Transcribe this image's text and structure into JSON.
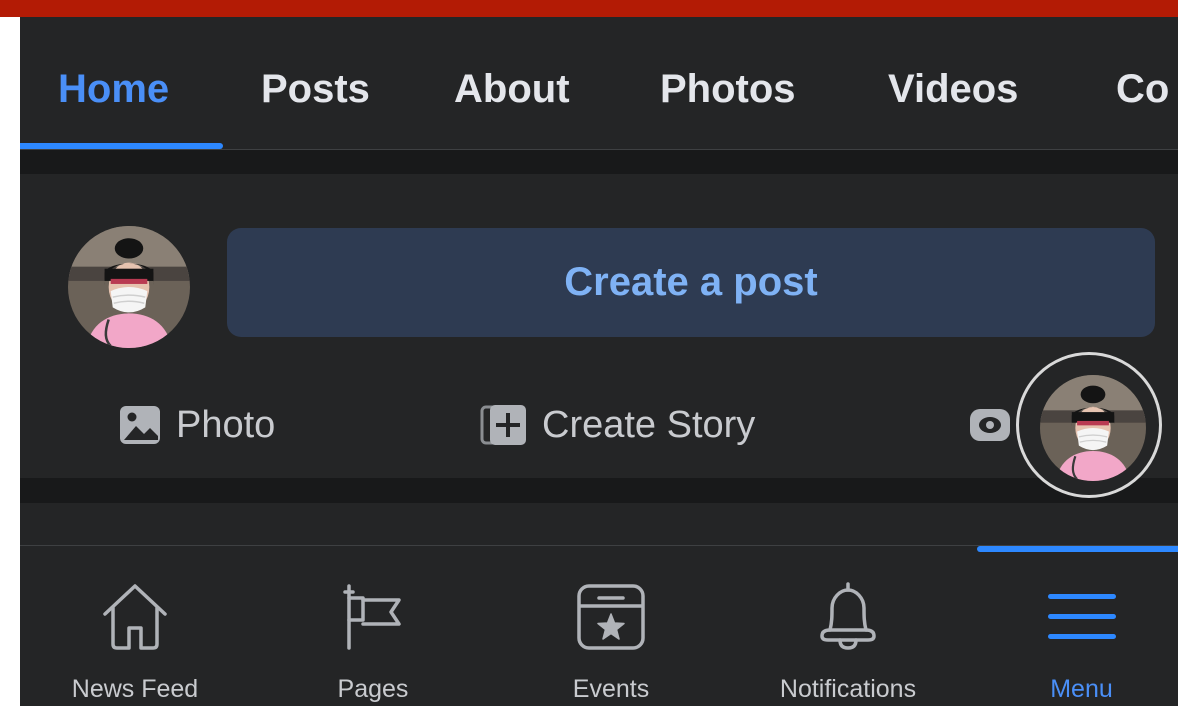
{
  "colors": {
    "accent": "#2d88ff",
    "accent_text": "#4a8ff7",
    "top_strip": "#b31b05",
    "surface": "#242526",
    "separator": "#18191a",
    "create_post_bg": "#2e3b52"
  },
  "tabs": [
    {
      "label": "Home",
      "active": true
    },
    {
      "label": "Posts",
      "active": false
    },
    {
      "label": "About",
      "active": false
    },
    {
      "label": "Photos",
      "active": false
    },
    {
      "label": "Videos",
      "active": false
    },
    {
      "label": "Co",
      "active": false
    }
  ],
  "composer": {
    "avatar_icon": "profile-avatar",
    "create_post_label": "Create a post",
    "actions": [
      {
        "label": "Photo",
        "icon": "photo-icon"
      },
      {
        "label": "Create Story",
        "icon": "create-story-icon"
      },
      {
        "label": "",
        "icon": "eye-icon"
      }
    ]
  },
  "chat_head": {
    "icon": "profile-avatar"
  },
  "bottom_nav": [
    {
      "label": "News Feed",
      "icon": "home-icon",
      "active": false
    },
    {
      "label": "Pages",
      "icon": "flag-icon",
      "active": false
    },
    {
      "label": "Events",
      "icon": "calendar-star-icon",
      "active": false
    },
    {
      "label": "Notifications",
      "icon": "bell-icon",
      "active": false
    },
    {
      "label": "Menu",
      "icon": "hamburger-menu-icon",
      "active": true
    }
  ]
}
